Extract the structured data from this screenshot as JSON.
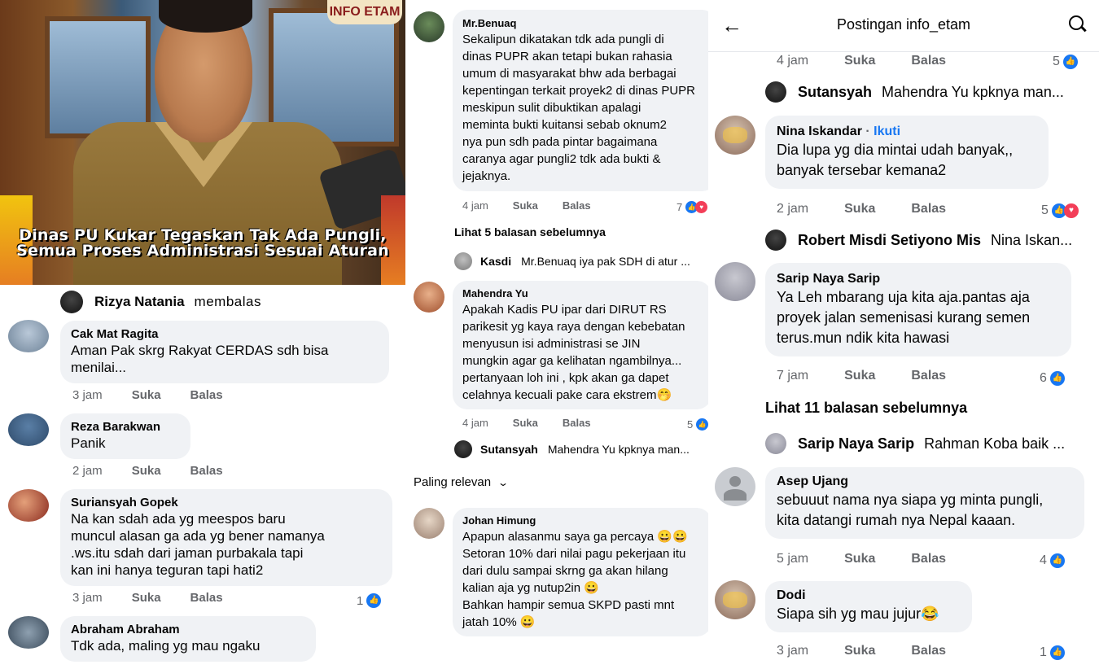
{
  "news": {
    "badge": "INFO ETAM",
    "caption": "Dinas PU Kukar Tegaskan Tak Ada Pungli, Semua Proses Administrasi Sesuai Aturan"
  },
  "col1": {
    "reply_header": {
      "name": "Rizya Natania",
      "action": "membalas"
    },
    "comments": [
      {
        "name": "Cak Mat Ragita",
        "text": "Aman Pak skrg Rakyat CERDAS  sdh bisa\nmenilai...",
        "time": "3 jam",
        "like": "Suka",
        "reply": "Balas"
      },
      {
        "name": "Reza Barakwan",
        "text": "Panik",
        "time": "2 jam",
        "like": "Suka",
        "reply": "Balas"
      },
      {
        "name": "Suriansyah Gopek",
        "text": "Na kan sdah ada yg meespos baru\nmuncul alasan ga ada yg bener namanya\n.ws.itu sdah dari jaman purbakala tapi\nkan ini hanya teguran tapi hati2",
        "time": "3 jam",
        "like": "Suka",
        "reply": "Balas",
        "count": "1"
      },
      {
        "name": "Abraham Abraham",
        "text": "Tdk ada, maling yg mau ngaku"
      }
    ]
  },
  "col2": {
    "comments": [
      {
        "name": "Mr.Benuaq",
        "text": "Sekalipun dikatakan tdk ada pungli di\ndinas PUPR akan tetapi bukan rahasia\numum di masyarakat bhw ada berbagai\nkepentingan terkait proyek2 di dinas PUPR\nmeskipun sulit dibuktikan apalagi\nmeminta bukti kuitansi sebab oknum2\nnya pun sdh pada pintar bagaimana\ncaranya agar pungli2 tdk ada bukti &\njejaknya.",
        "time": "4 jam",
        "like": "Suka",
        "reply": "Balas",
        "count": "7"
      },
      {
        "name": "Mahendra Yu",
        "text": "Apakah Kadis PU ipar dari DIRUT RS\nparikesit yg kaya raya dengan kebebatan\nmenyusun isi administrasi se JIN\nmungkin agar ga kelihatan ngambilnya...\npertanyaan loh ini  , kpk akan ga dapet\ncelahnya kecuali pake cara ekstrem🤭",
        "time": "4 jam",
        "like": "Suka",
        "reply": "Balas",
        "count": "5"
      },
      {
        "name": "Johan Himung",
        "text": "Apapun alasanmu saya ga percaya 😀😀\nSetoran 10% dari nilai pagu pekerjaan itu\ndari dulu sampai skrng ga akan hilang\nkalian aja yg nutup2in 😀\nBahkan hampir semua SKPD pasti mnt\njatah 10% 😀"
      }
    ],
    "see_more": "Lihat 5 balasan sebelumnya",
    "reply_kasdi": {
      "name": "Kasdi",
      "text": "Mr.Benuaq iya pak SDH di atur ..."
    },
    "reply_sutansyah": {
      "name": "Sutansyah",
      "text": "Mahendra Yu kpknya man..."
    },
    "sort_label": "Paling relevan"
  },
  "col3": {
    "title": "Postingan info_etam",
    "first_meta": {
      "time": "4 jam",
      "like": "Suka",
      "reply": "Balas",
      "count": "5"
    },
    "reply_sutansyah": {
      "name": "Sutansyah",
      "text": "Mahendra Yu kpknya man..."
    },
    "reply_robert": {
      "name": "Robert Misdi Setiyono Mis",
      "text": "Nina Iskan..."
    },
    "reply_sarip": {
      "name": "Sarip Naya Sarip",
      "text": "Rahman Koba baik ..."
    },
    "see_more": "Lihat 11 balasan sebelumnya",
    "follow_label": "Ikuti",
    "comments": [
      {
        "name": "Nina Iskandar",
        "text": "Dia lupa yg dia mintai udah banyak,,\nbanyak tersebar kemana2",
        "time": "2 jam",
        "like": "Suka",
        "reply": "Balas",
        "count": "5"
      },
      {
        "name": "Sarip Naya Sarip",
        "text": "Ya Leh mbarang uja kita aja.pantas aja\nproyek jalan semenisasi kurang semen\nterus.mun ndik kita hawasi",
        "time": "7 jam",
        "like": "Suka",
        "reply": "Balas",
        "count": "6"
      },
      {
        "name": "Asep Ujang",
        "text": "sebuuut nama nya siapa yg minta pungli,\nkita datangi rumah nya Nepal kaaan.",
        "time": "5 jam",
        "like": "Suka",
        "reply": "Balas",
        "count": "4"
      },
      {
        "name": "Dodi",
        "text": "Siapa sih yg mau jujur😂",
        "time": "3 jam",
        "like": "Suka",
        "reply": "Balas",
        "count": "1"
      }
    ]
  }
}
